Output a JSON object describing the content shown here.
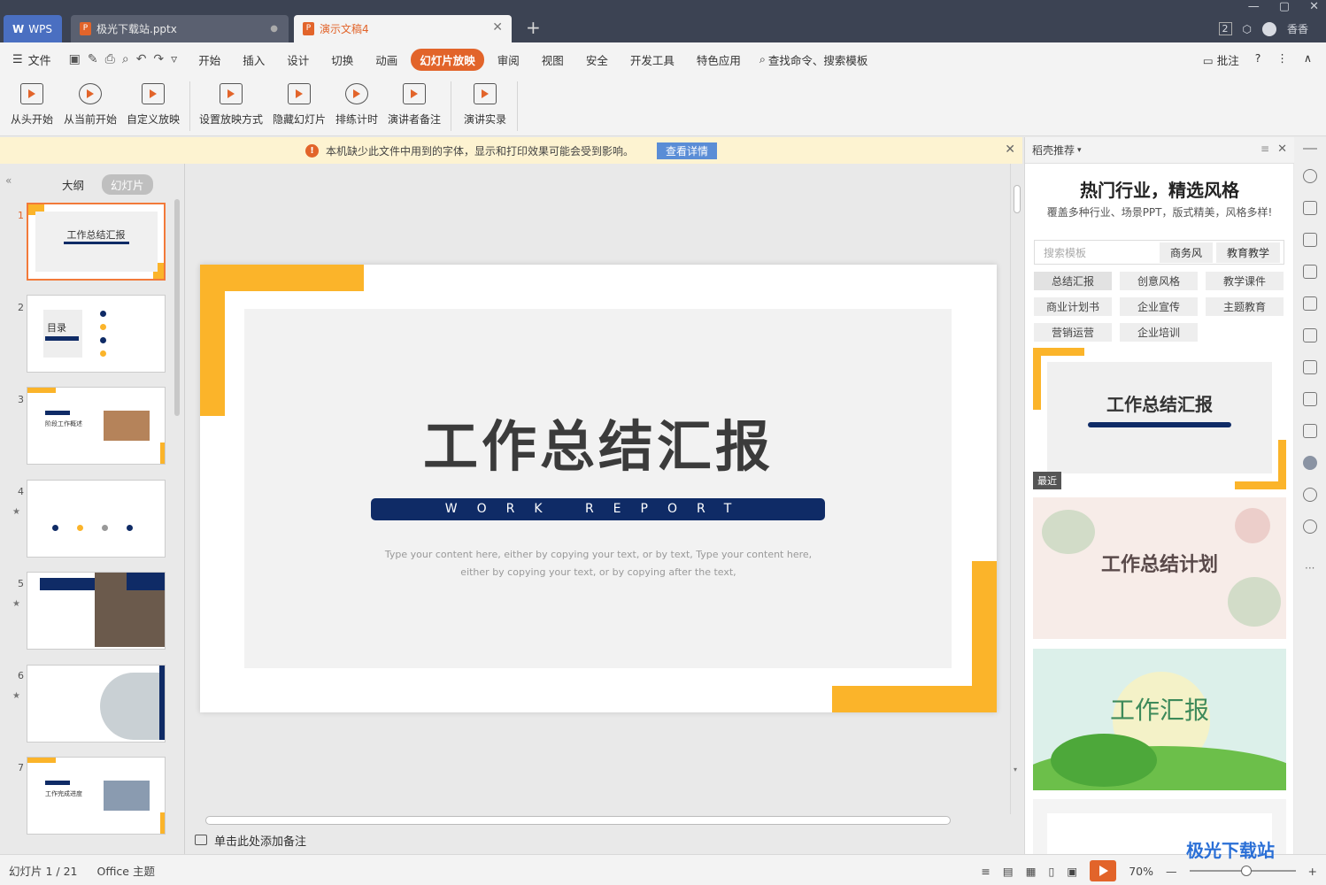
{
  "tabs": {
    "wps": "WPS",
    "file1": "极光下载站.pptx",
    "file2": "演示文稿4",
    "file1_dot": "●",
    "file2_close": "✕",
    "add": "+"
  },
  "window": {
    "badge": "2",
    "user": "香香",
    "controls": [
      "—",
      "▢",
      "✕"
    ]
  },
  "menubar": {
    "file": "文件",
    "items": [
      "开始",
      "插入",
      "设计",
      "切换",
      "动画",
      "幻灯片放映",
      "审阅",
      "视图",
      "安全",
      "开发工具",
      "特色应用"
    ],
    "active_index": 5,
    "search": "查找命令、搜索模板",
    "comment": "批注",
    "help": "?",
    "more": "⋮",
    "collapse": "∧"
  },
  "ribbon": {
    "buttons": [
      "从头开始",
      "从当前开始",
      "自定义放映",
      "设置放映方式",
      "隐藏幻灯片",
      "排练计时",
      "演讲者备注",
      "演讲实录"
    ]
  },
  "notification": {
    "message": "本机缺少此文件中用到的字体，显示和打印效果可能会受到影响。",
    "detail_button": "查看详情",
    "warn_symbol": "!",
    "close": "✕"
  },
  "left_panel": {
    "collapse": "«",
    "tab_outline": "大纲",
    "tab_slides": "幻灯片",
    "thumbnails": [
      {
        "num": "1",
        "title": "工作总结汇报",
        "star": ""
      },
      {
        "num": "2",
        "title": "目录",
        "star": ""
      },
      {
        "num": "3",
        "title": "阶段工作概述",
        "star": ""
      },
      {
        "num": "4",
        "title": "",
        "star": "★"
      },
      {
        "num": "5",
        "title": "",
        "star": "★"
      },
      {
        "num": "6",
        "title": "",
        "star": "★"
      },
      {
        "num": "7",
        "title": "工作完成进度",
        "star": ""
      }
    ]
  },
  "slide": {
    "title": "工作总结汇报",
    "subtitle": "WORK REPORT",
    "desc_line1": "Type your content here, either by copying your text, or by text, Type your content here,",
    "desc_line2": "either by copying your text, or by copying after the text,"
  },
  "notes": {
    "placeholder": "单击此处添加备注"
  },
  "right_panel": {
    "header": "稻壳推荐",
    "header_arrow": "▾",
    "menu": "≡",
    "close": "✕",
    "title": "热门行业，精选风格",
    "subtitle": "覆盖多种行业、场景PPT，版式精美，风格多样!",
    "search_placeholder": "搜索模板",
    "search_chips": [
      "商务风",
      "教育教学"
    ],
    "tags": [
      "总结汇报",
      "创意风格",
      "教学课件",
      "商业计划书",
      "企业宣传",
      "主题教育",
      "营销运营",
      "企业培训"
    ],
    "templates": [
      {
        "title": "工作总结汇报",
        "label": "最近"
      },
      {
        "title": "工作总结计划",
        "label": ""
      },
      {
        "title": "工作汇报",
        "label": ""
      }
    ]
  },
  "statusbar": {
    "slide_info": "幻灯片 1 / 21",
    "theme": "Office 主题",
    "zoom": "70%",
    "zoom_minus": "—",
    "zoom_plus": "+"
  },
  "watermark": "极光下载站",
  "colors": {
    "accent": "#e2642a",
    "slide_navy": "#0f2b66",
    "slide_yellow": "#fbb42a",
    "tabbar": "#3c4353"
  }
}
